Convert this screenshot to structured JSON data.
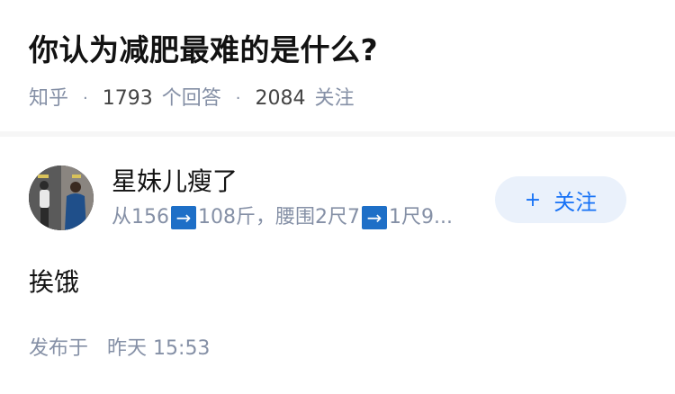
{
  "question": {
    "title": "你认为减肥最难的是什么?",
    "source": "知乎",
    "answers_count": "1793",
    "answers_label": "个回答",
    "followers_count": "2084",
    "followers_label": "关注"
  },
  "answer": {
    "author_name": "星妹儿瘦了",
    "bio_part1": "从156",
    "bio_part2": "108斤，腰围2尺7",
    "bio_part3": "1尺9...",
    "arrow_glyph": "→",
    "follow_label": "关注",
    "follow_plus": "+",
    "body": "挨饿",
    "publish_prefix": "发布于",
    "publish_day": "昨天",
    "publish_time": "15:53"
  },
  "colors": {
    "accent": "#1772f6",
    "meta": "#8590a6",
    "arrow_badge": "#1e6fc7"
  }
}
